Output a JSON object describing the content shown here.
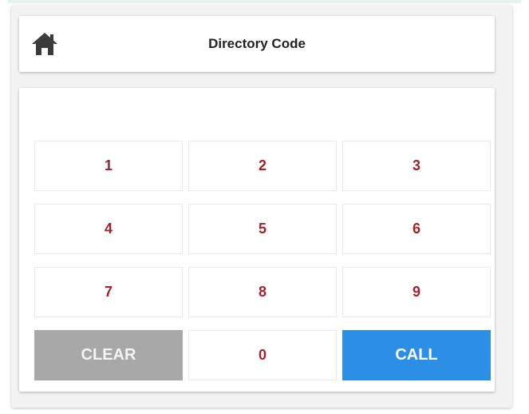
{
  "header": {
    "title": "Directory Code",
    "home_icon": "home-icon"
  },
  "display": {
    "value": ""
  },
  "keypad": {
    "key_1": "1",
    "key_2": "2",
    "key_3": "3",
    "key_4": "4",
    "key_5": "5",
    "key_6": "6",
    "key_7": "7",
    "key_8": "8",
    "key_9": "9",
    "key_0": "0",
    "clear_label": "CLEAR",
    "call_label": "CALL"
  },
  "colors": {
    "digit_text": "#a4202a",
    "clear_bg": "#a8a8a8",
    "call_bg": "#2b8fe6"
  }
}
